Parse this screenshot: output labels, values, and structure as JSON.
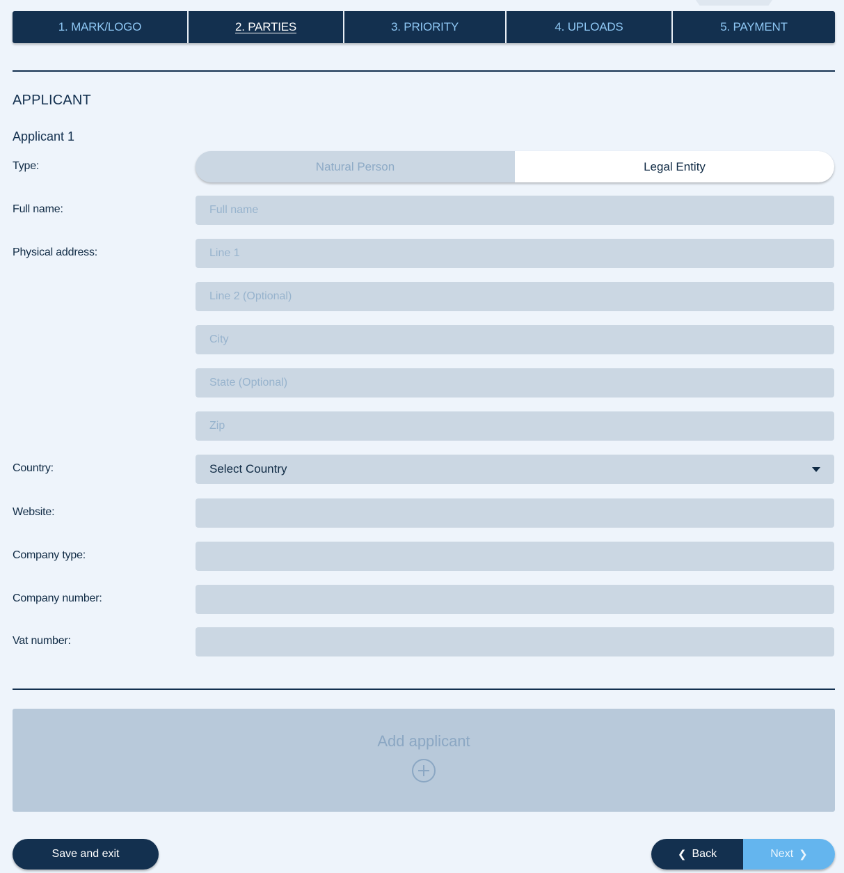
{
  "steps": [
    {
      "label": "1. MARK/LOGO"
    },
    {
      "label": "2. PARTIES"
    },
    {
      "label": "3. PRIORITY"
    },
    {
      "label": "4. UPLOADS"
    },
    {
      "label": "5. PAYMENT"
    }
  ],
  "active_step": "2. PARTIES",
  "section": {
    "title": "APPLICANT",
    "subtitle": "Applicant 1"
  },
  "form": {
    "type_label": "Type:",
    "type_options": [
      "Natural Person",
      "Legal Entity"
    ],
    "type_selected": "Legal Entity",
    "full_name_label": "Full name:",
    "full_name_placeholder": "Full name",
    "address_label": "Physical address:",
    "line1_placeholder": "Line 1",
    "line2_placeholder": "Line 2 (Optional)",
    "city_placeholder": "City",
    "state_placeholder": "State (Optional)",
    "zip_placeholder": "Zip",
    "country_label": "Country:",
    "country_value": "Select Country",
    "website_label": "Website:",
    "company_type_label": "Company type:",
    "company_number_label": "Company number:",
    "vat_number_label": "Vat number:"
  },
  "add_applicant": {
    "label": "Add applicant",
    "icon": "plus-circle-icon"
  },
  "buttons": {
    "save_exit": "Save and exit",
    "back": "Back",
    "next": "Next"
  },
  "colors": {
    "navy": "#13304f",
    "page_bg": "#eef4fb",
    "field_bg": "#cbd7e3",
    "accent_blue": "#64b5ee",
    "step_text": "#8fc8f5"
  }
}
